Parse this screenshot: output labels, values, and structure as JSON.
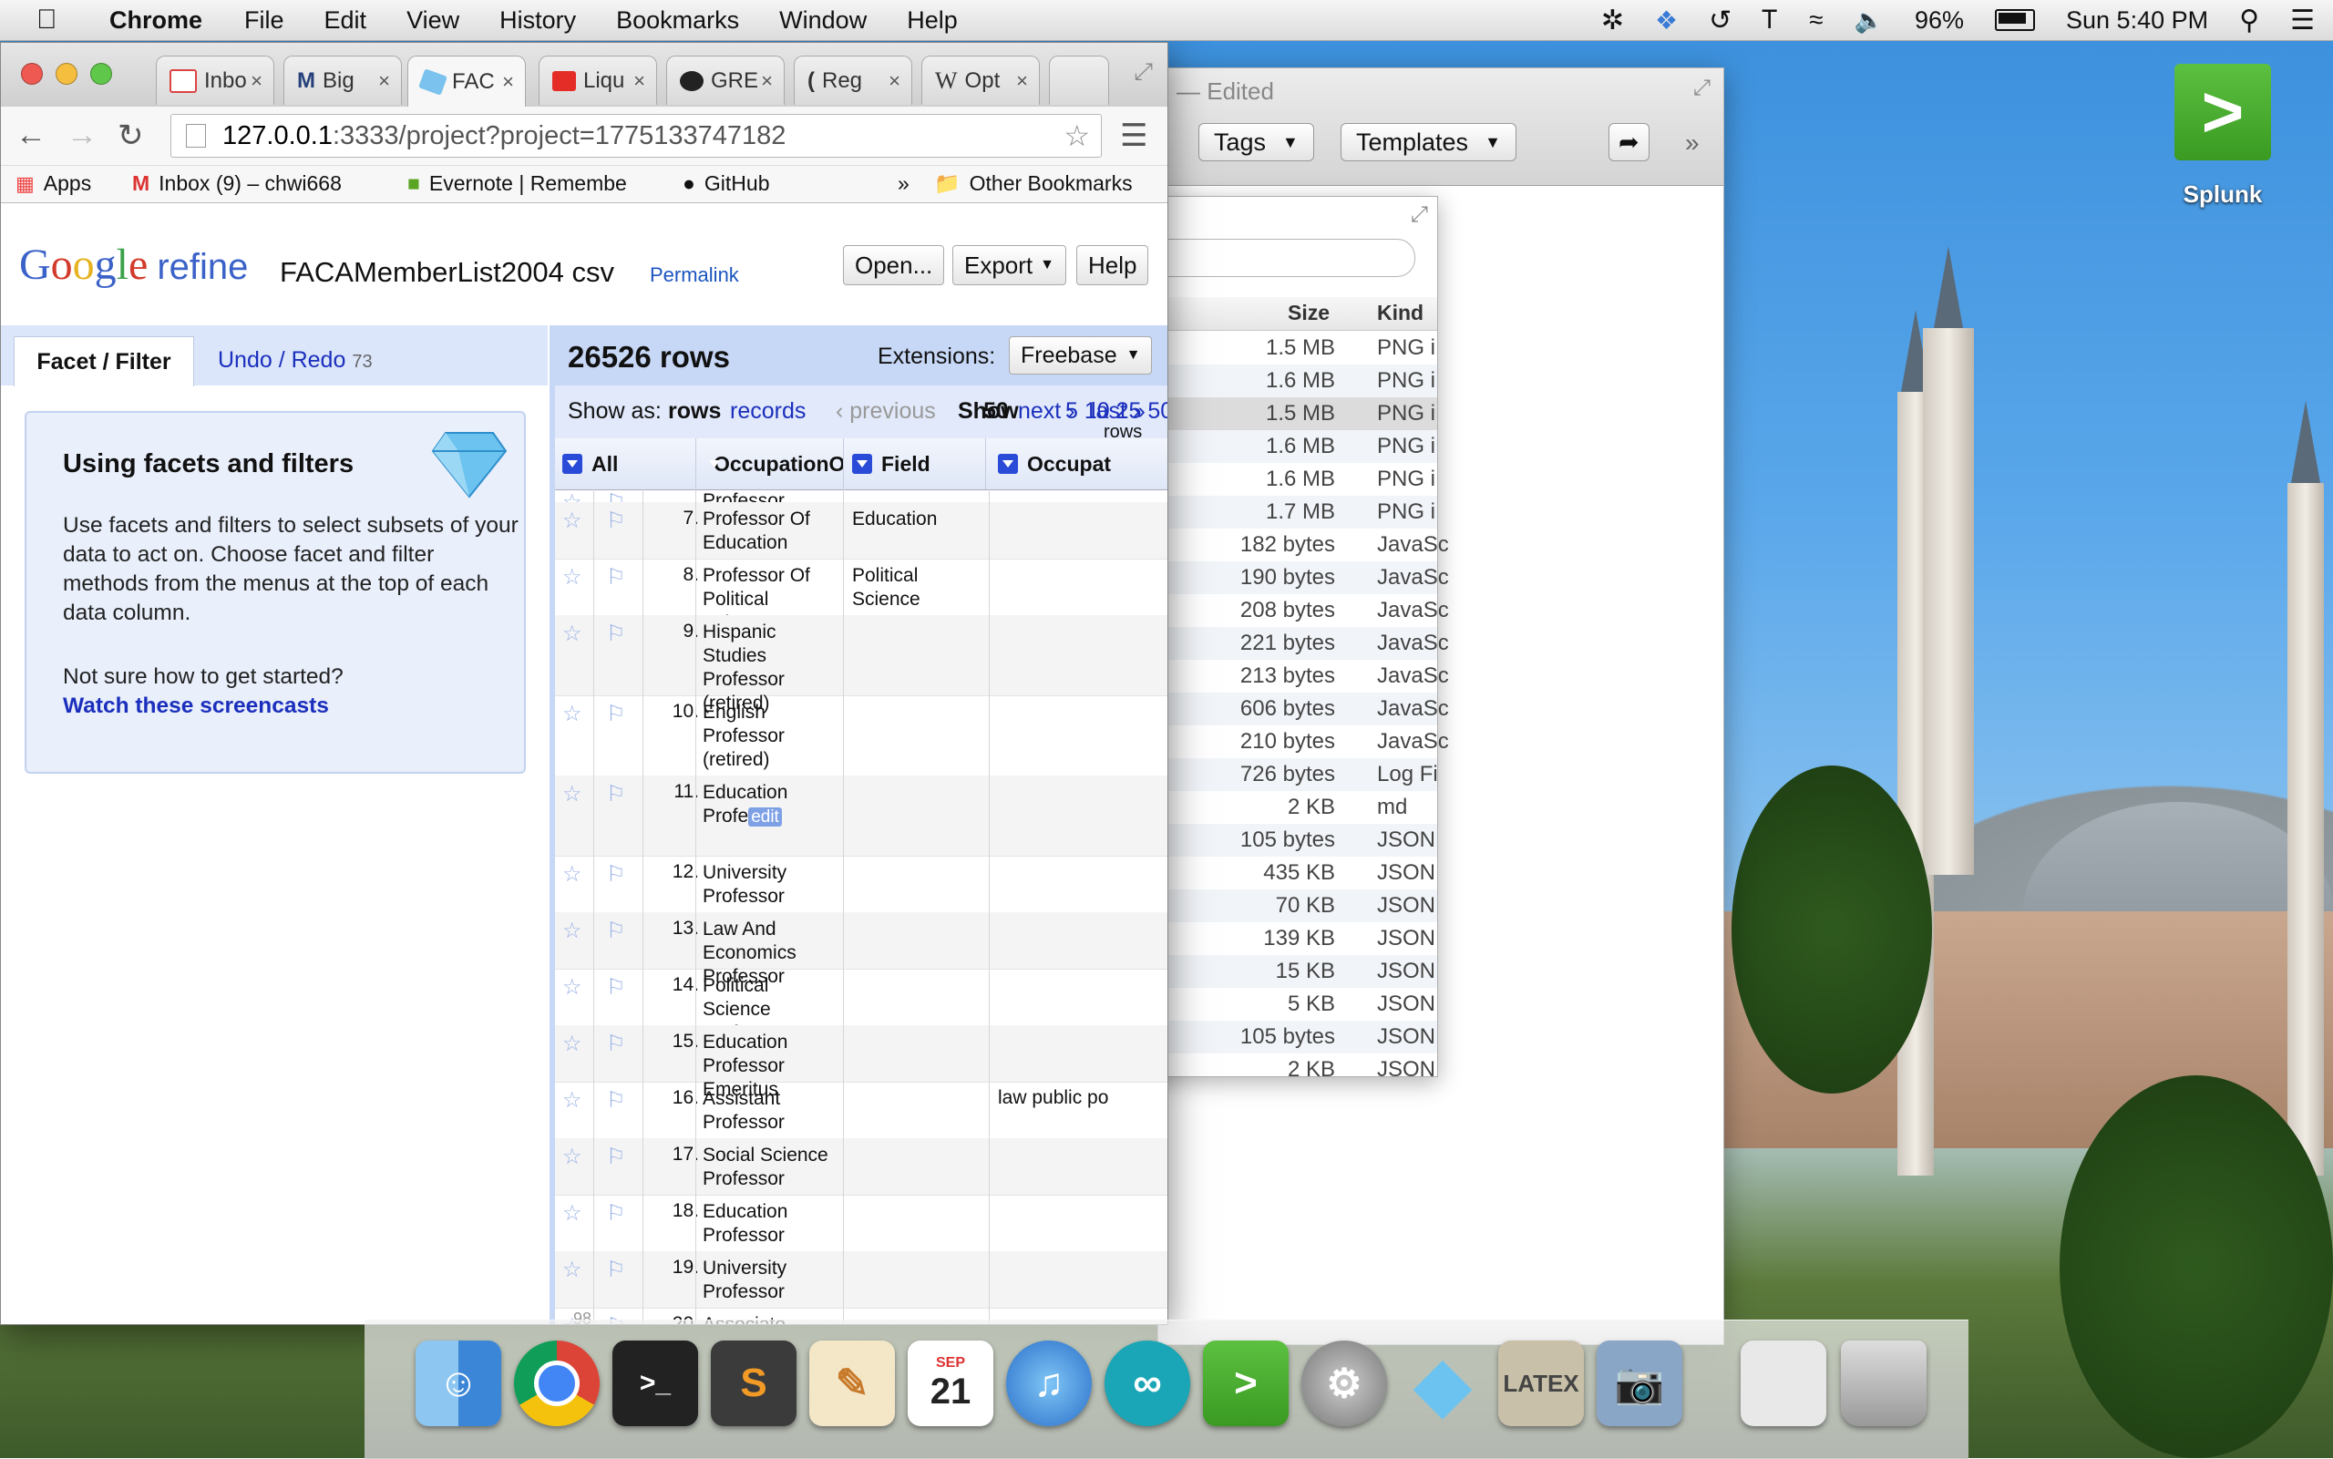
{
  "menubar": {
    "app": "Chrome",
    "items": [
      "File",
      "Edit",
      "View",
      "History",
      "Bookmarks",
      "Window",
      "Help"
    ],
    "battery": "96%",
    "clock": "Sun 5:40 PM"
  },
  "desktop": {
    "splunk_label": "Splunk"
  },
  "finder": {
    "edited": "— Edited",
    "tags": "Tags",
    "templates": "Templates",
    "col_size": "Size",
    "col_kind": "Kind",
    "rows": [
      {
        "size": "1.5 MB",
        "kind": "PNG i"
      },
      {
        "size": "1.6 MB",
        "kind": "PNG i"
      },
      {
        "size": "1.5 MB",
        "kind": "PNG i"
      },
      {
        "size": "1.6 MB",
        "kind": "PNG i"
      },
      {
        "size": "1.6 MB",
        "kind": "PNG i"
      },
      {
        "size": "1.7 MB",
        "kind": "PNG i"
      },
      {
        "size": "182 bytes",
        "kind": "JavaSc"
      },
      {
        "size": "190 bytes",
        "kind": "JavaSc"
      },
      {
        "size": "208 bytes",
        "kind": "JavaSc"
      },
      {
        "size": "221 bytes",
        "kind": "JavaSc"
      },
      {
        "size": "213 bytes",
        "kind": "JavaSc"
      },
      {
        "size": "606 bytes",
        "kind": "JavaSc"
      },
      {
        "size": "210 bytes",
        "kind": "JavaSc"
      },
      {
        "size": "726 bytes",
        "kind": "Log Fi"
      },
      {
        "size": "2 KB",
        "kind": "md"
      },
      {
        "size": "105 bytes",
        "kind": "JSON"
      },
      {
        "size": "435 KB",
        "kind": "JSON"
      },
      {
        "size": "70 KB",
        "kind": "JSON"
      },
      {
        "size": "139 KB",
        "kind": "JSON"
      },
      {
        "size": "15 KB",
        "kind": "JSON"
      },
      {
        "size": "5 KB",
        "kind": "JSON"
      },
      {
        "size": "105 bytes",
        "kind": "JSON"
      },
      {
        "size": "2 KB",
        "kind": "JSON"
      }
    ]
  },
  "chrome": {
    "tabs": [
      "Inbo",
      "Big",
      "FAC",
      "Liqu",
      "GRE",
      "Reg",
      "Opt"
    ],
    "url_host": "127.0.0.1",
    "url_path": ":3333/project?project=1775133747182",
    "bookmarks": {
      "apps": "Apps",
      "inbox": "Inbox (9) – chwi668",
      "evernote": "Evernote | Remembe",
      "github": "GitHub",
      "overflow": "»",
      "other": "Other Bookmarks"
    }
  },
  "refine": {
    "logo_g": [
      "G",
      "o",
      "o",
      "g",
      "l",
      "e"
    ],
    "logo_refine": "refine",
    "project_name": "FACAMemberList2004 csv",
    "permalink": "Permalink",
    "buttons": {
      "open": "Open...",
      "export": "Export",
      "help": "Help"
    },
    "tabs": {
      "facet": "Facet / Filter",
      "undo": "Undo / Redo",
      "undo_count": "73"
    },
    "help": {
      "title": "Using facets and filters",
      "body": "Use facets and filters to select subsets of your data to act on. Choose facet and filter methods from the menus at the top of each data column.",
      "question": "Not sure how to get started?",
      "link": "Watch these screencasts"
    },
    "rowcount": "26526 rows",
    "extensions_label": "Extensions:",
    "freebase": "Freebase",
    "showas": {
      "label": "Show as:",
      "rows": "rows",
      "records": "records",
      "previous": "‹ previous",
      "show": "Show",
      "n50": "50",
      "next": "next ›",
      "last": "last »",
      "sizes": "5 10 25 50",
      "rows_word": "rows"
    },
    "columns": {
      "all": "All",
      "occ": "OccupationOrAf",
      "field": "Field",
      "occ2": "Occupat"
    },
    "rows": [
      {
        "n": "",
        "occ": "Professor",
        "field": "",
        "occ2": ""
      },
      {
        "n": "7.",
        "occ": "Professor Of Education",
        "field": "Education",
        "occ2": ""
      },
      {
        "n": "8.",
        "occ": "Professor Of Political Science",
        "field": "Political Science",
        "occ2": ""
      },
      {
        "n": "9.",
        "occ": "Hispanic Studies Professor (retired)",
        "field": "",
        "occ2": ""
      },
      {
        "n": "10.",
        "occ": "English Professor (retired)",
        "field": "",
        "occ2": ""
      },
      {
        "n": "11.",
        "occ": "Education Profe",
        "field": "",
        "occ2": ""
      },
      {
        "n": "12.",
        "occ": "University Professor",
        "field": "",
        "occ2": ""
      },
      {
        "n": "13.",
        "occ": "Law And Economics Professor",
        "field": "",
        "occ2": ""
      },
      {
        "n": "14.",
        "occ": "Political Science Professor",
        "field": "",
        "occ2": ""
      },
      {
        "n": "15.",
        "occ": "Education Professor Emeritus",
        "field": "",
        "occ2": ""
      },
      {
        "n": "16.",
        "occ": "Assistant Professor",
        "field": "",
        "occ2": "law public po"
      },
      {
        "n": "17.",
        "occ": "Social Science Professor",
        "field": "",
        "occ2": ""
      },
      {
        "n": "18.",
        "occ": "Education Professor",
        "field": "",
        "occ2": ""
      },
      {
        "n": "19.",
        "occ": "University Professor",
        "field": "",
        "occ2": ""
      },
      {
        "n": "20.",
        "occ": "Associate Professor",
        "field": "",
        "occ2": ""
      }
    ],
    "edit_tag": "edit",
    "scroll_hint": "98"
  },
  "dock": {
    "apps": [
      "finder-icon",
      "chrome-icon",
      "terminal-icon",
      "sublime-icon",
      "pages-icon",
      "calendar-icon",
      "itunes-icon",
      "arduino-icon",
      "splunk-icon",
      "system-preferences-icon",
      "refine-icon",
      "latex-icon",
      "preview-icon",
      "documents-icon",
      "trash-icon"
    ],
    "calendar_month": "SEP",
    "calendar_day": "21",
    "latex_label": "LATEX"
  }
}
